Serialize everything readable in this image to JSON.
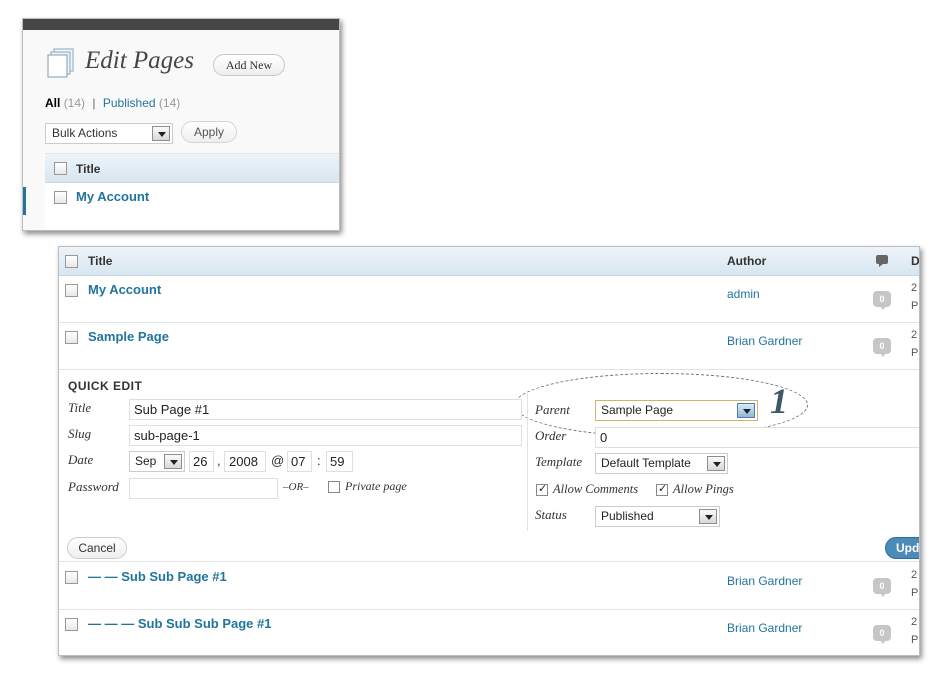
{
  "top_panel": {
    "heading": "Edit Pages",
    "add_new": "Add New",
    "filters": {
      "all_label": "All",
      "all_count": "(14)",
      "separator": "|",
      "published_label": "Published",
      "published_count": "(14)"
    },
    "bulk_actions": "Bulk Actions",
    "apply": "Apply",
    "column_title": "Title",
    "row_title": "My Account"
  },
  "list": {
    "columns": {
      "title": "Title",
      "author": "Author",
      "date_fragment": "D"
    },
    "rows": [
      {
        "title": "My Account",
        "author": "admin",
        "comments": "0",
        "date_line1": "2",
        "date_line2": "P"
      },
      {
        "title": "Sample Page",
        "author": "Brian Gardner",
        "comments": "0",
        "date_line1": "2",
        "date_line2": "P"
      },
      {
        "title": "— — Sub Sub Page #1",
        "author": "Brian Gardner",
        "comments": "0",
        "date_line1": "2",
        "date_line2": "P"
      },
      {
        "title": "— — — Sub Sub Sub Page #1",
        "author": "Brian Gardner",
        "comments": "0",
        "date_line1": "2",
        "date_line2": "P"
      }
    ]
  },
  "quick_edit": {
    "heading": "QUICK EDIT",
    "title_label": "Title",
    "title_value": "Sub Page #1",
    "slug_label": "Slug",
    "slug_value": "sub-page-1",
    "date_label": "Date",
    "month": "Sep",
    "day": "26",
    "comma": ",",
    "year": "2008",
    "at": "@",
    "hour": "07",
    "colon": ":",
    "minute": "59",
    "password_label": "Password",
    "password_value": "",
    "or_text": "–OR–",
    "private_label": "Private page",
    "parent_label": "Parent",
    "parent_value": "Sample Page",
    "order_label": "Order",
    "order_value": "0",
    "template_label": "Template",
    "template_value": "Default Template",
    "allow_comments_label": "Allow Comments",
    "allow_pings_label": "Allow Pings",
    "status_label": "Status",
    "status_value": "Published",
    "cancel": "Cancel",
    "update": "Upd"
  },
  "annotation": {
    "number": "1"
  },
  "colors": {
    "link": "#21759b",
    "header_gradient_top": "#eef4f9",
    "header_gradient_bottom": "#d7e6f1",
    "admin_bar": "#464646",
    "update_button": "#4c8ab8"
  },
  "icons": [
    "pages-icon",
    "comment-bubble-icon",
    "dropdown-arrow-icon",
    "checkbox-icon"
  ]
}
